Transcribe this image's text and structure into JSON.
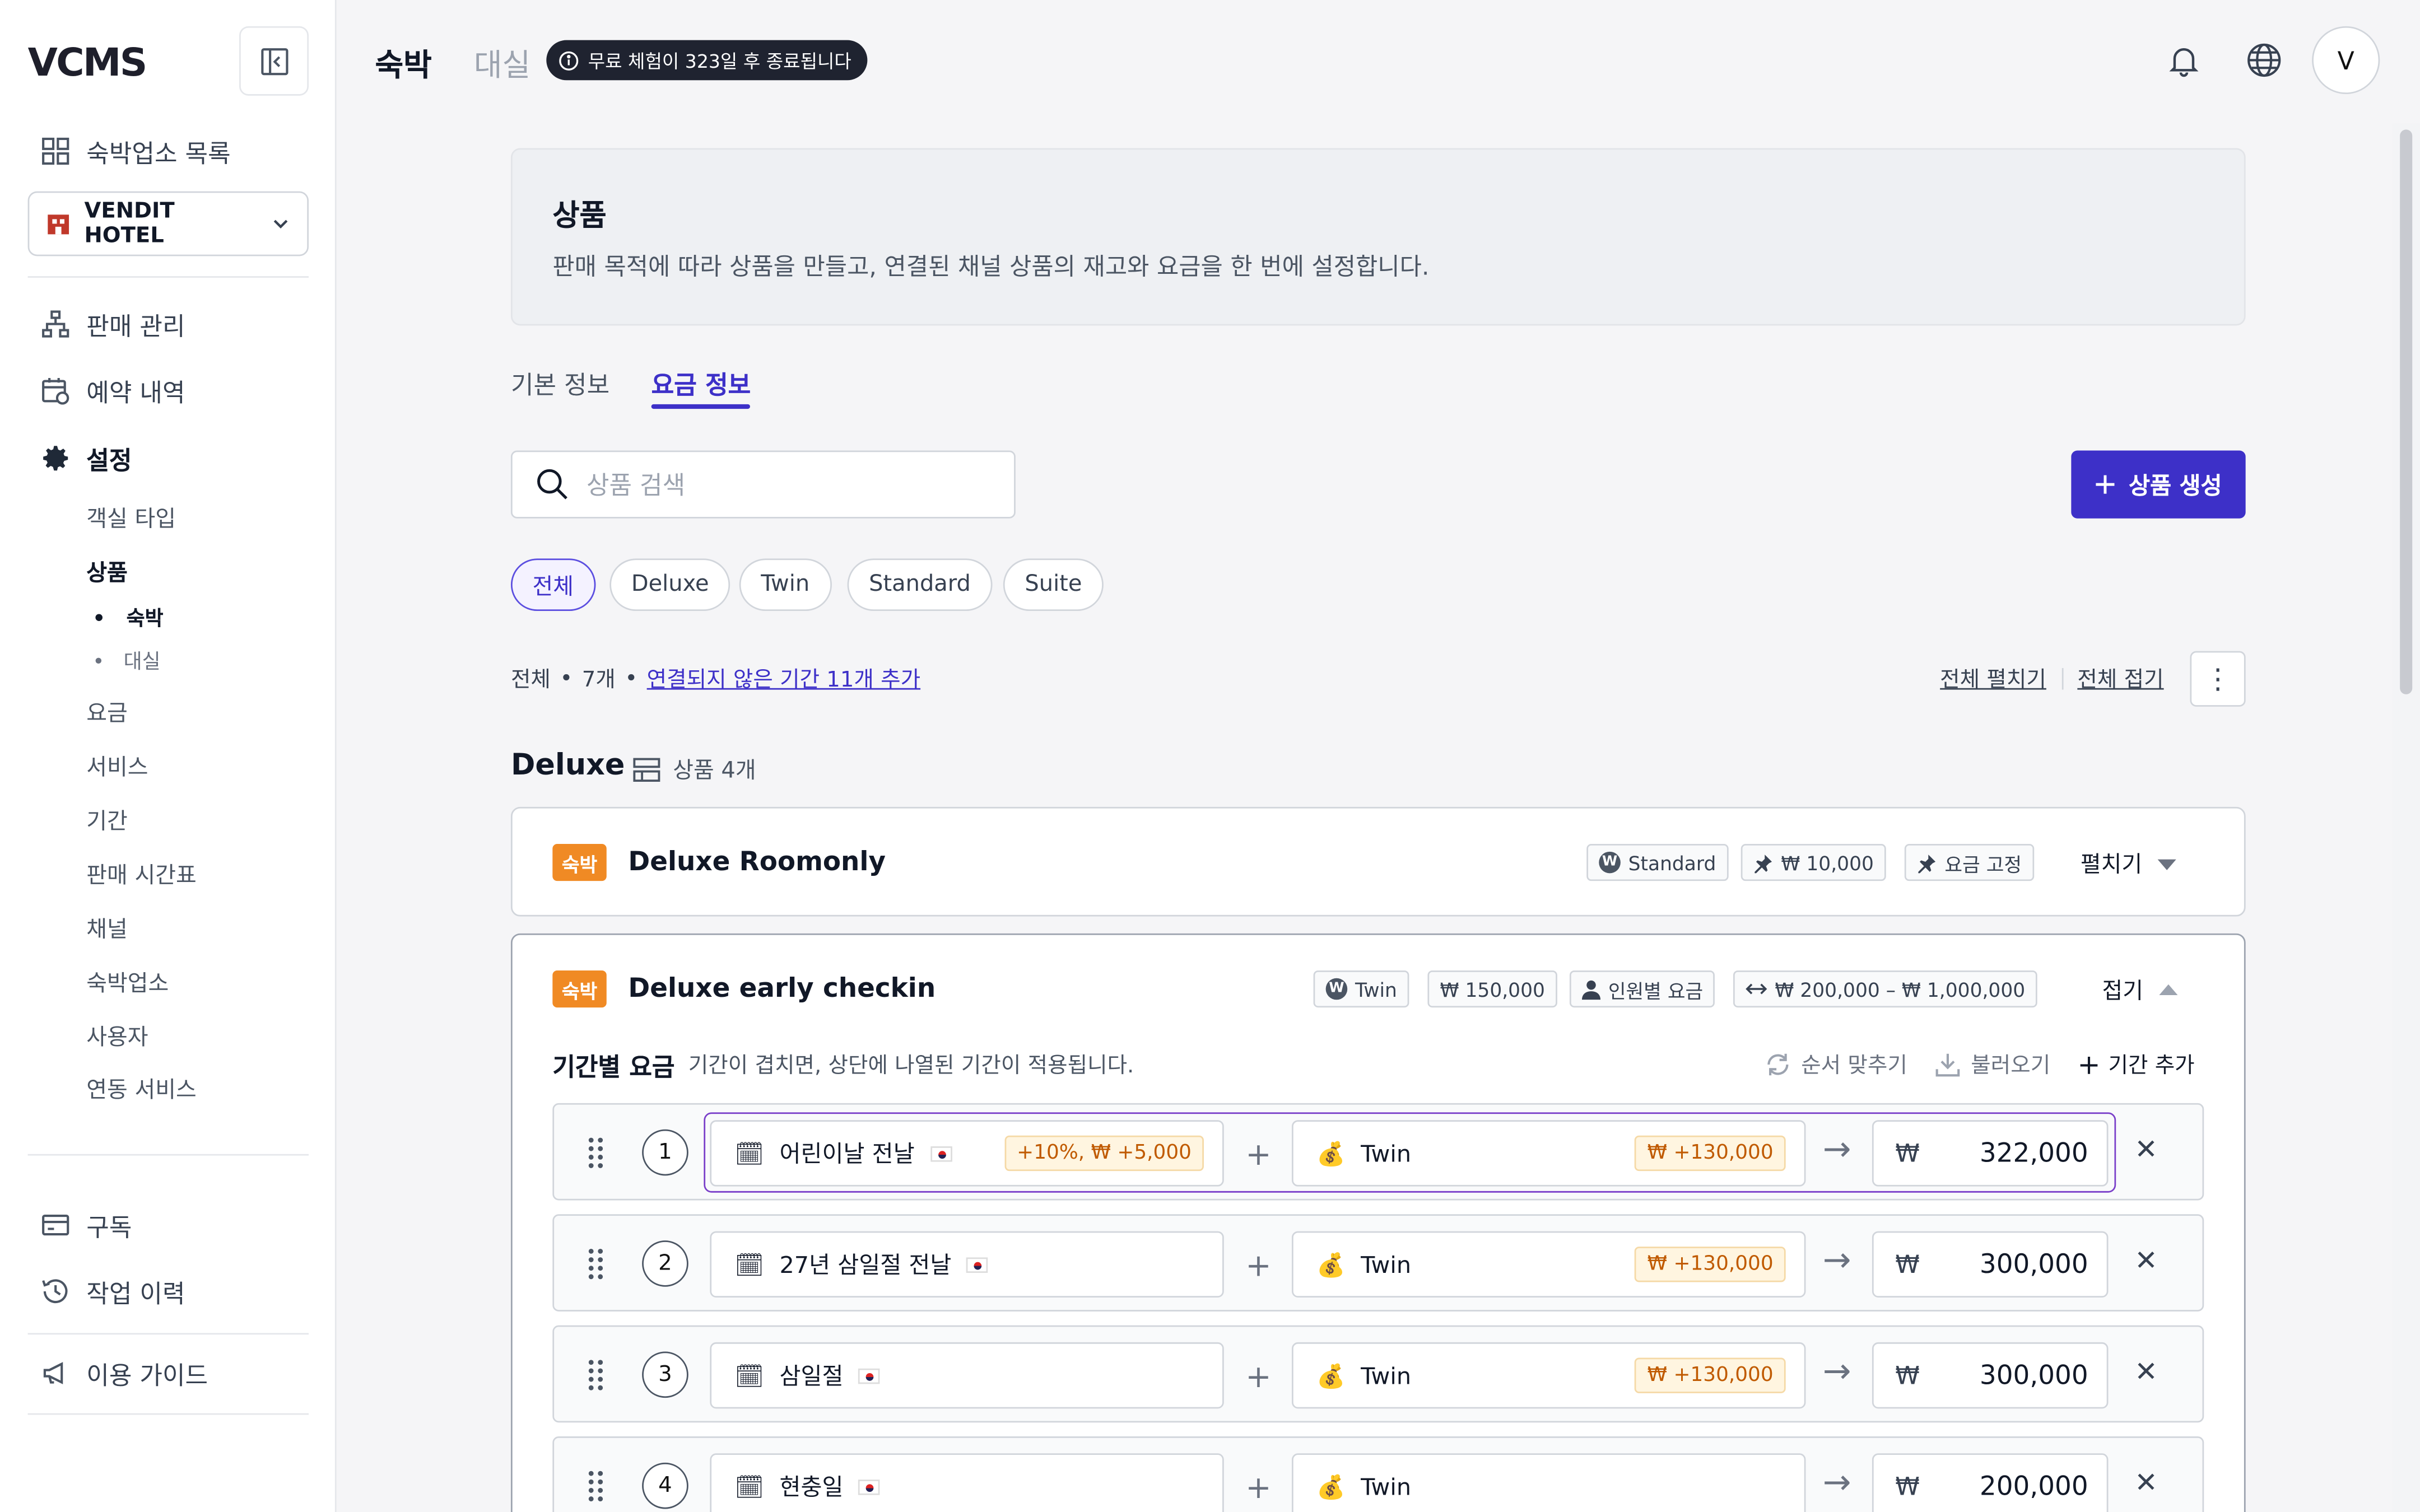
{
  "app": {
    "logo": "VCMS"
  },
  "sidebar": {
    "property_list": "숙박업소 목록",
    "hotel_name": "VENDIT HOTEL",
    "sales": "판매 관리",
    "reservations": "예약 내역",
    "settings": "설정",
    "settings_items": [
      "객실 타입",
      "상품",
      "요금",
      "서비스",
      "기간",
      "판매 시간표",
      "채널",
      "숙박업소",
      "사용자",
      "연동 서비스"
    ],
    "product_sub": [
      "숙박",
      "대실"
    ],
    "subscription": "구독",
    "history": "작업 이력",
    "guide": "이용 가이드"
  },
  "topbar": {
    "tab_stay": "숙박",
    "tab_rent": "대실",
    "trial": "무료 체험이 323일 후 종료됩니다",
    "avatar": "V"
  },
  "header": {
    "title": "상품",
    "desc": "판매 목적에 따라 상품을 만들고, 연결된 채널 상품의 재고와 요금을 한 번에 설정합니다."
  },
  "tabs": [
    "기본 정보",
    "요금 정보"
  ],
  "search": {
    "placeholder": "상품 검색",
    "create": "상품 생성"
  },
  "filters": [
    "전체",
    "Deluxe",
    "Twin",
    "Standard",
    "Suite"
  ],
  "summary": {
    "all": "전체",
    "count": "7개",
    "link": "연결되지 않은 기간 11개 추가",
    "expand_all": "전체 펼치기",
    "collapse_all": "전체 접기"
  },
  "group": {
    "title": "Deluxe",
    "count": "상품 4개"
  },
  "products": [
    {
      "badge": "숙박",
      "name": "Deluxe Roomonly",
      "tags": [
        "Standard",
        "₩ 10,000",
        "요금 고정"
      ],
      "toggle": "펼치기"
    },
    {
      "badge": "숙박",
      "name": "Deluxe early checkin",
      "tags": [
        "Twin",
        "₩ 150,000",
        "인원별 요금",
        "₩ 200,000 – ₩ 1,000,000"
      ],
      "toggle": "접기"
    }
  ],
  "period": {
    "title": "기간별 요금",
    "desc": "기간이 겹치면, 상단에 나열된 기간이 적용됩니다.",
    "reorder": "순서 맞추기",
    "import": "불러오기",
    "add": "기간 추가",
    "rows": [
      {
        "num": "1",
        "period": "어린이날 전날",
        "period_mod": "+10%, ₩ +5,000",
        "room": "Twin",
        "room_mod": "₩ +130,000",
        "currency": "₩",
        "price": "322,000"
      },
      {
        "num": "2",
        "period": "27년 삼일절 전날",
        "period_mod": "",
        "room": "Twin",
        "room_mod": "₩ +130,000",
        "currency": "₩",
        "price": "300,000"
      },
      {
        "num": "3",
        "period": "삼일절",
        "period_mod": "",
        "room": "Twin",
        "room_mod": "₩ +130,000",
        "currency": "₩",
        "price": "300,000"
      },
      {
        "num": "4",
        "period": "현충일",
        "period_mod": "",
        "room": "Twin",
        "room_mod": "",
        "currency": "₩",
        "price": "200,000"
      }
    ]
  }
}
